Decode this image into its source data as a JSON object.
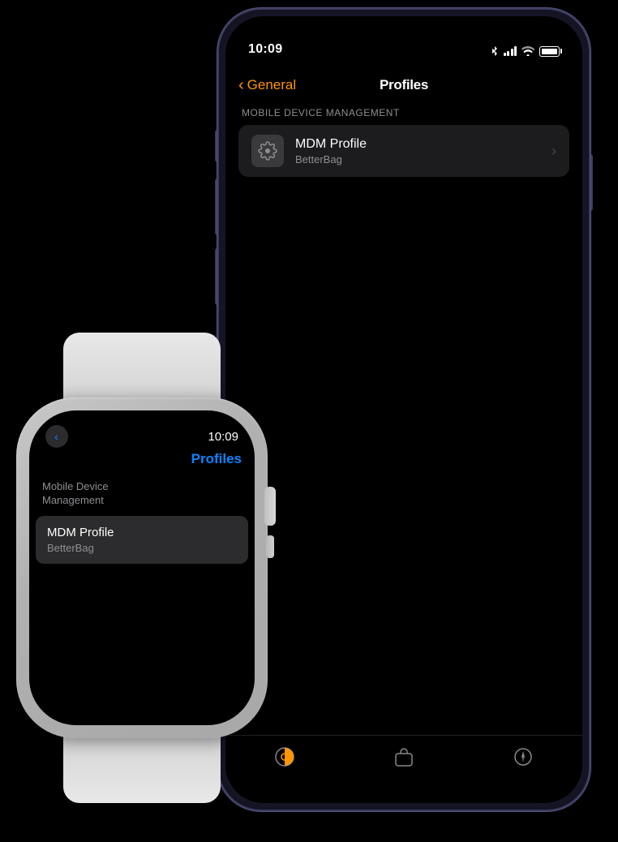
{
  "iphone": {
    "status_bar": {
      "time": "10:09",
      "signal": "●●●●",
      "wifi": "wifi",
      "battery": "battery"
    },
    "nav": {
      "back_label": "General",
      "title": "Profiles"
    },
    "section": {
      "label": "MOBILE DEVICE MANAGEMENT"
    },
    "profile_item": {
      "title": "MDM Profile",
      "subtitle": "BetterBag"
    },
    "tabbar": {
      "tab1_icon": "circle-half",
      "tab2_icon": "bag",
      "tab3_icon": "compass"
    }
  },
  "watch": {
    "status": {
      "time": "10:09",
      "back_label": "back"
    },
    "title": "Profiles",
    "section_label": "Mobile Device\nManagement",
    "profile_item": {
      "title": "MDM Profile",
      "subtitle": "BetterBag"
    }
  }
}
